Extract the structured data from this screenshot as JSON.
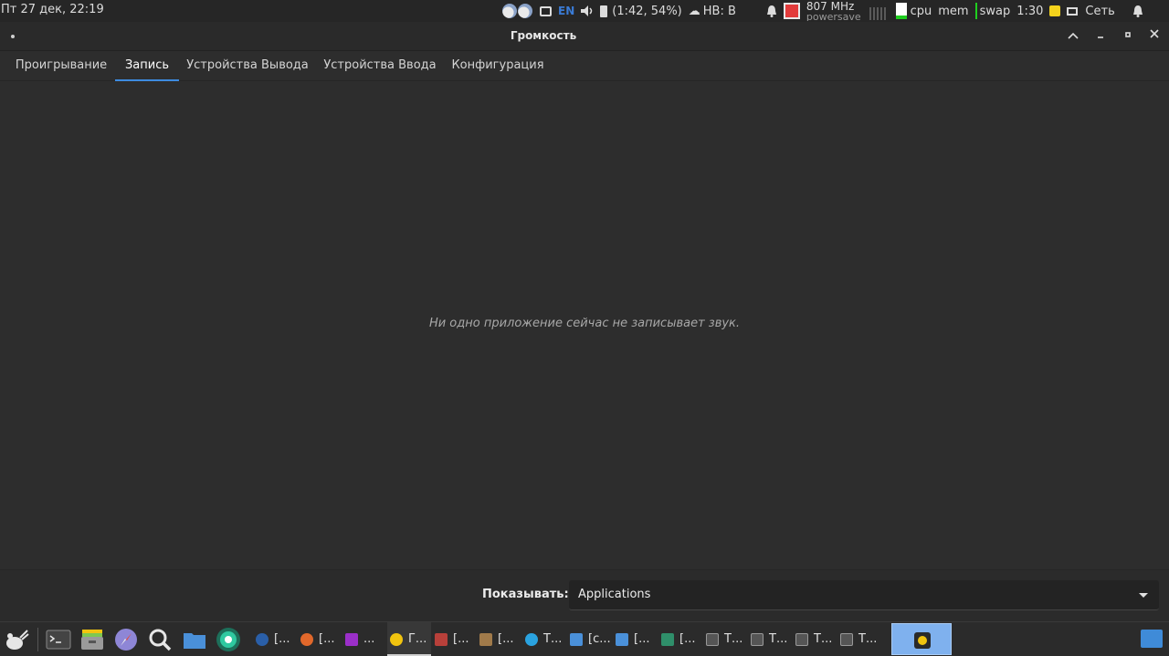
{
  "top_panel": {
    "clock": "Пт 27 дек, 22:19",
    "lang": "EN",
    "battery": "(1:42, 54%)",
    "weather": "НВ: В",
    "cpu_freq": "807 MHz",
    "cpu_governor": "powersave",
    "cpu_label": "cpu",
    "mem_label": "mem",
    "swap_label": "swap",
    "time_short": "1:30",
    "network": "Сеть"
  },
  "window": {
    "title": "Громкость"
  },
  "tabs": [
    {
      "label": "Проигрывание"
    },
    {
      "label": "Запись"
    },
    {
      "label": "Устройства Вывода"
    },
    {
      "label": "Устройства Ввода"
    },
    {
      "label": "Конфигурация"
    }
  ],
  "active_tab": "Запись",
  "main": {
    "empty_message": "Ни одно приложение сейчас не записывает звук."
  },
  "bottom": {
    "show_label": "Показывать:",
    "show_value": "Applications"
  },
  "taskbar": {
    "tasks": [
      {
        "label": "[..."
      },
      {
        "label": "[..."
      },
      {
        "label": "..."
      },
      {
        "label": "Г..."
      },
      {
        "label": "[..."
      },
      {
        "label": "[..."
      },
      {
        "label": "Т..."
      },
      {
        "label": "[c..."
      },
      {
        "label": "[..."
      },
      {
        "label": "[..."
      },
      {
        "label": "Т..."
      },
      {
        "label": "Т..."
      },
      {
        "label": "Т..."
      },
      {
        "label": "Т..."
      }
    ]
  },
  "colors": {
    "accent": "#3d8be0",
    "background": "#2d2d2d",
    "cpu_indicator": "#e23b3b",
    "meter_green": "#1fcf1f"
  }
}
